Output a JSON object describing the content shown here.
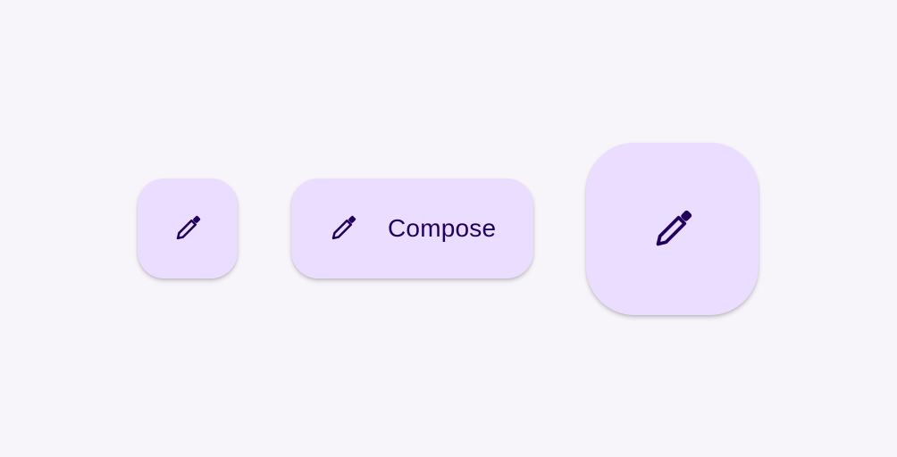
{
  "colors": {
    "background": "#F7F5FA",
    "container": "#EADDFF",
    "on_container": "#21005D"
  },
  "buttons": {
    "small": {
      "icon": "pencil-icon"
    },
    "extended": {
      "icon": "pencil-icon",
      "label": "Compose"
    },
    "large": {
      "icon": "pencil-icon"
    }
  }
}
